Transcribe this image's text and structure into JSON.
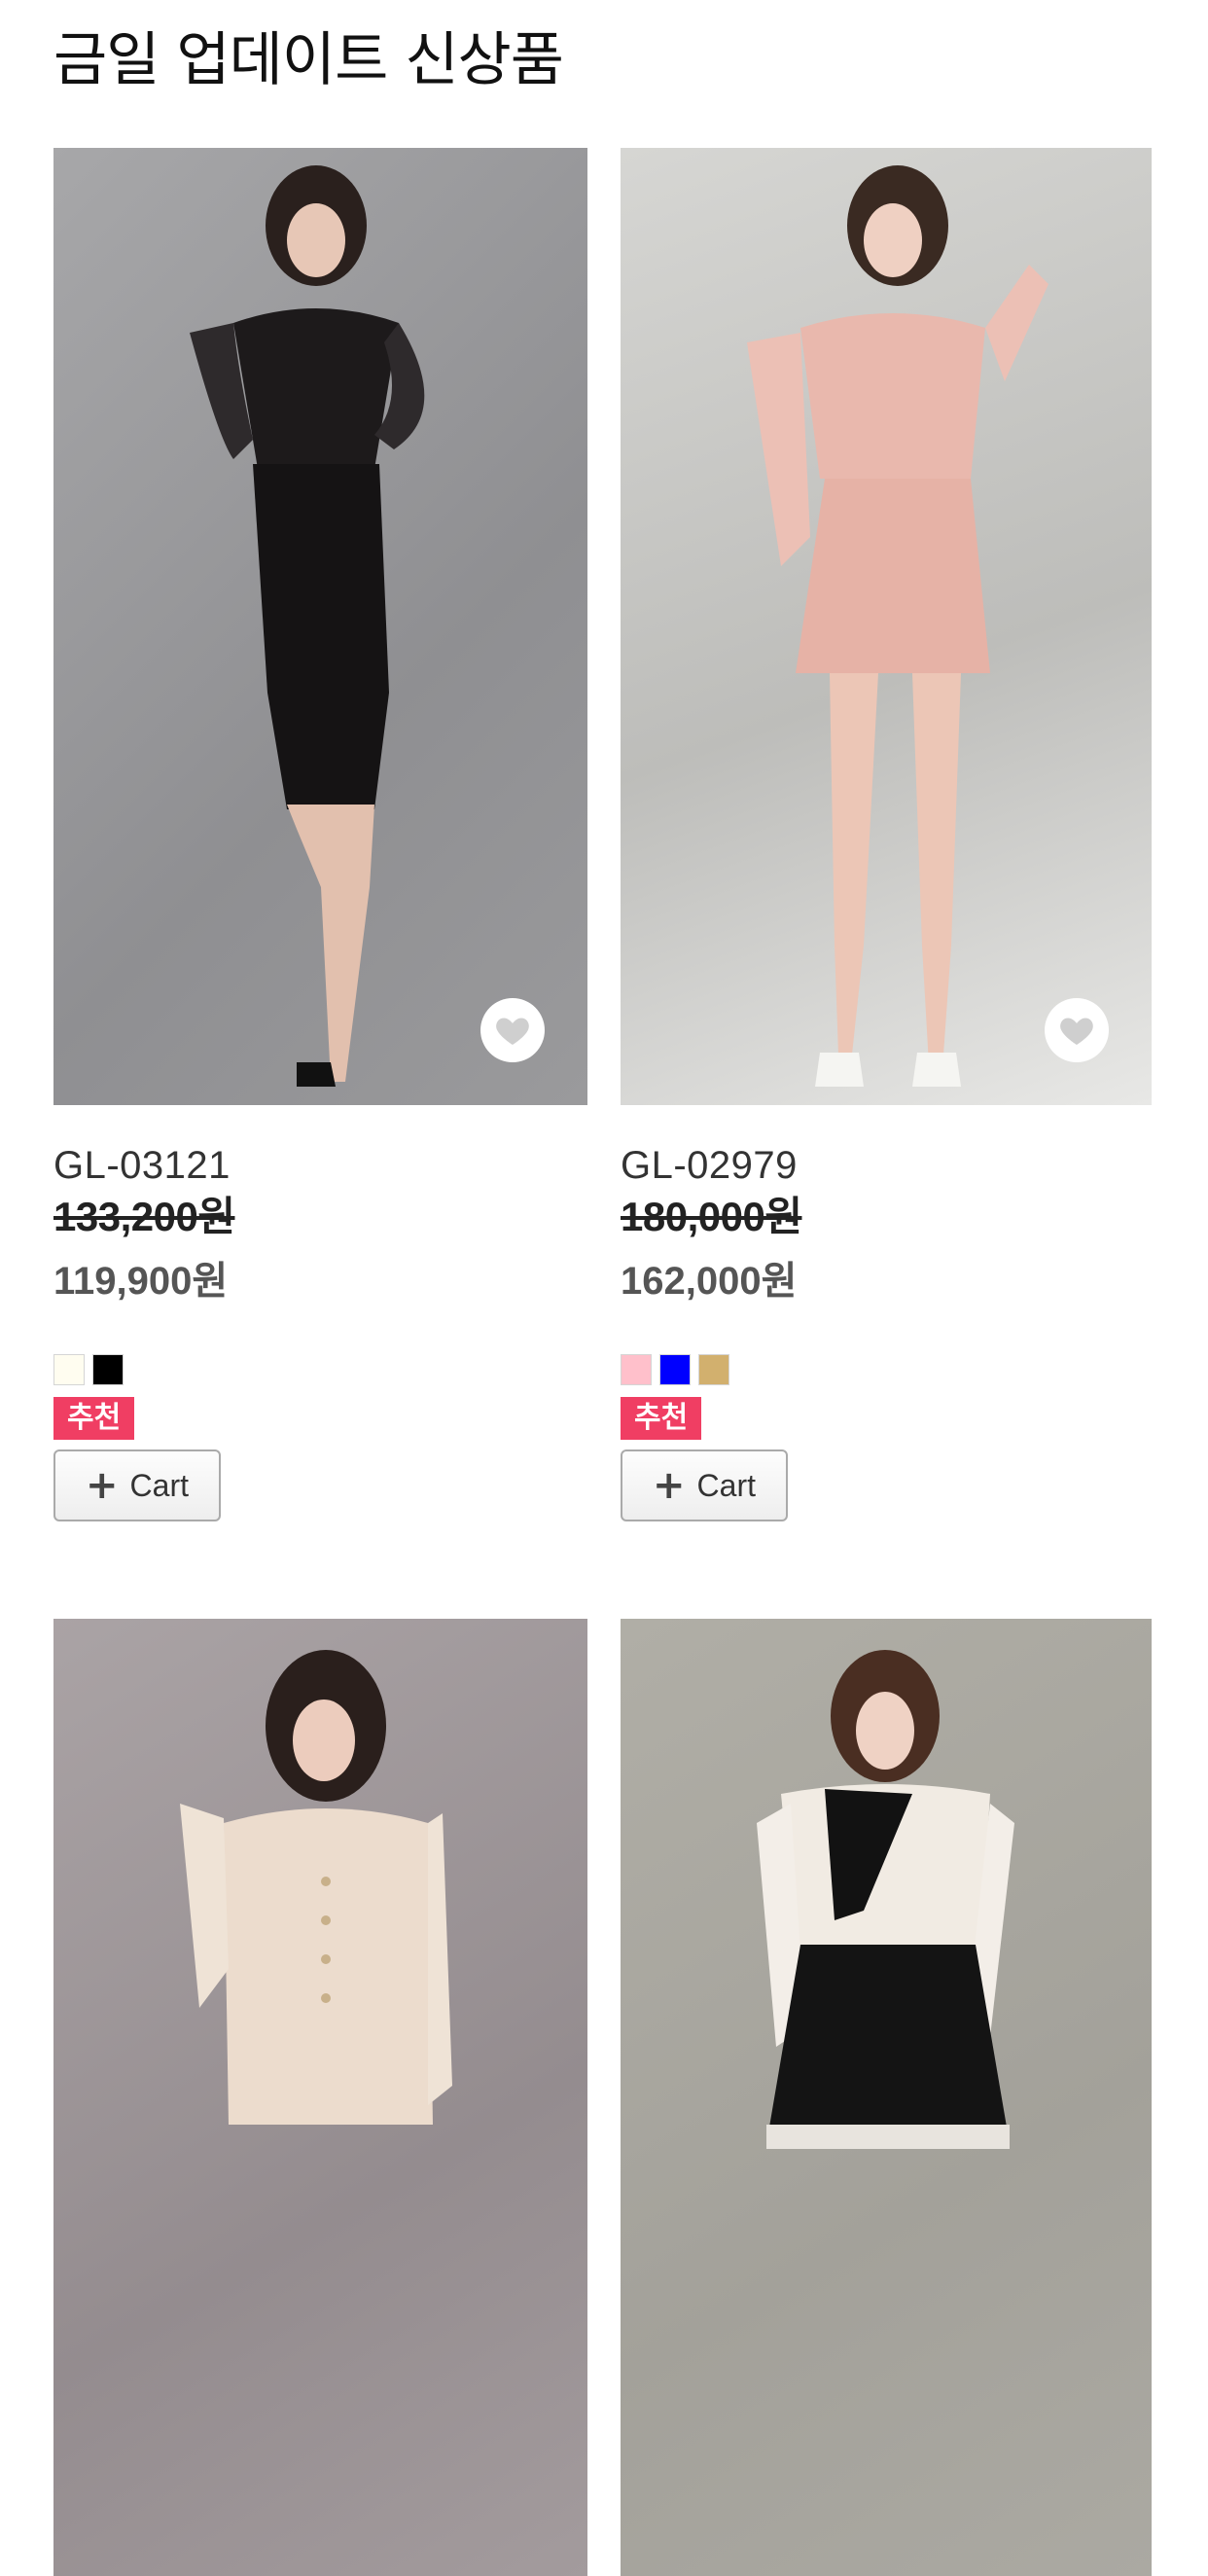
{
  "page": {
    "title": "금일 업데이트 신상품"
  },
  "icons": {
    "wishlist": "heart-icon",
    "cart": "plus-icon"
  },
  "colors": {
    "badge": "#f03e63",
    "sale_price": "#555555"
  },
  "products": [
    {
      "code": "GL-03121",
      "original_price": "133,200원",
      "sale_price": "119,900원",
      "swatches": [
        "#fffdf0",
        "#000000"
      ],
      "badge": "추천",
      "cart_label": "Cart"
    },
    {
      "code": "GL-02979",
      "original_price": "180,000원",
      "sale_price": "162,000원",
      "swatches": [
        "#ffc0cb",
        "#0000ff",
        "#d2b06e"
      ],
      "badge": "추천",
      "cart_label": "Cart"
    },
    {},
    {}
  ]
}
